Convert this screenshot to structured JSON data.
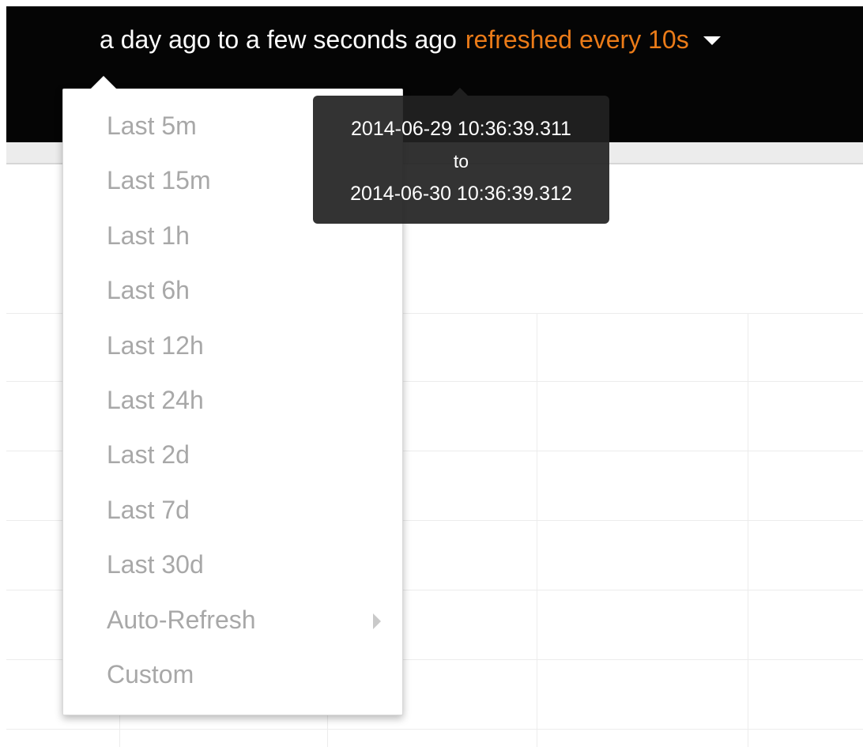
{
  "header": {
    "range_label": "a day ago to a few seconds ago",
    "refresh_label": "refreshed every 10s",
    "caret_icon": "caret-down-icon"
  },
  "colors": {
    "header_bg": "#050505",
    "refresh_accent": "#eb7b18",
    "menu_text": "#a8a8a8"
  },
  "time_menu": {
    "items": [
      {
        "label": "Last 5m"
      },
      {
        "label": "Last 15m"
      },
      {
        "label": "Last 1h"
      },
      {
        "label": "Last 6h"
      },
      {
        "label": "Last 12h"
      },
      {
        "label": "Last 24h"
      },
      {
        "label": "Last 2d"
      },
      {
        "label": "Last 7d"
      },
      {
        "label": "Last 30d"
      },
      {
        "label": "Auto-Refresh",
        "submenu_icon": "caret-right-icon"
      },
      {
        "label": "Custom"
      }
    ]
  },
  "tooltip": {
    "from": "2014-06-29 10:36:39.311",
    "separator": "to",
    "to": "2014-06-30 10:36:39.312"
  }
}
